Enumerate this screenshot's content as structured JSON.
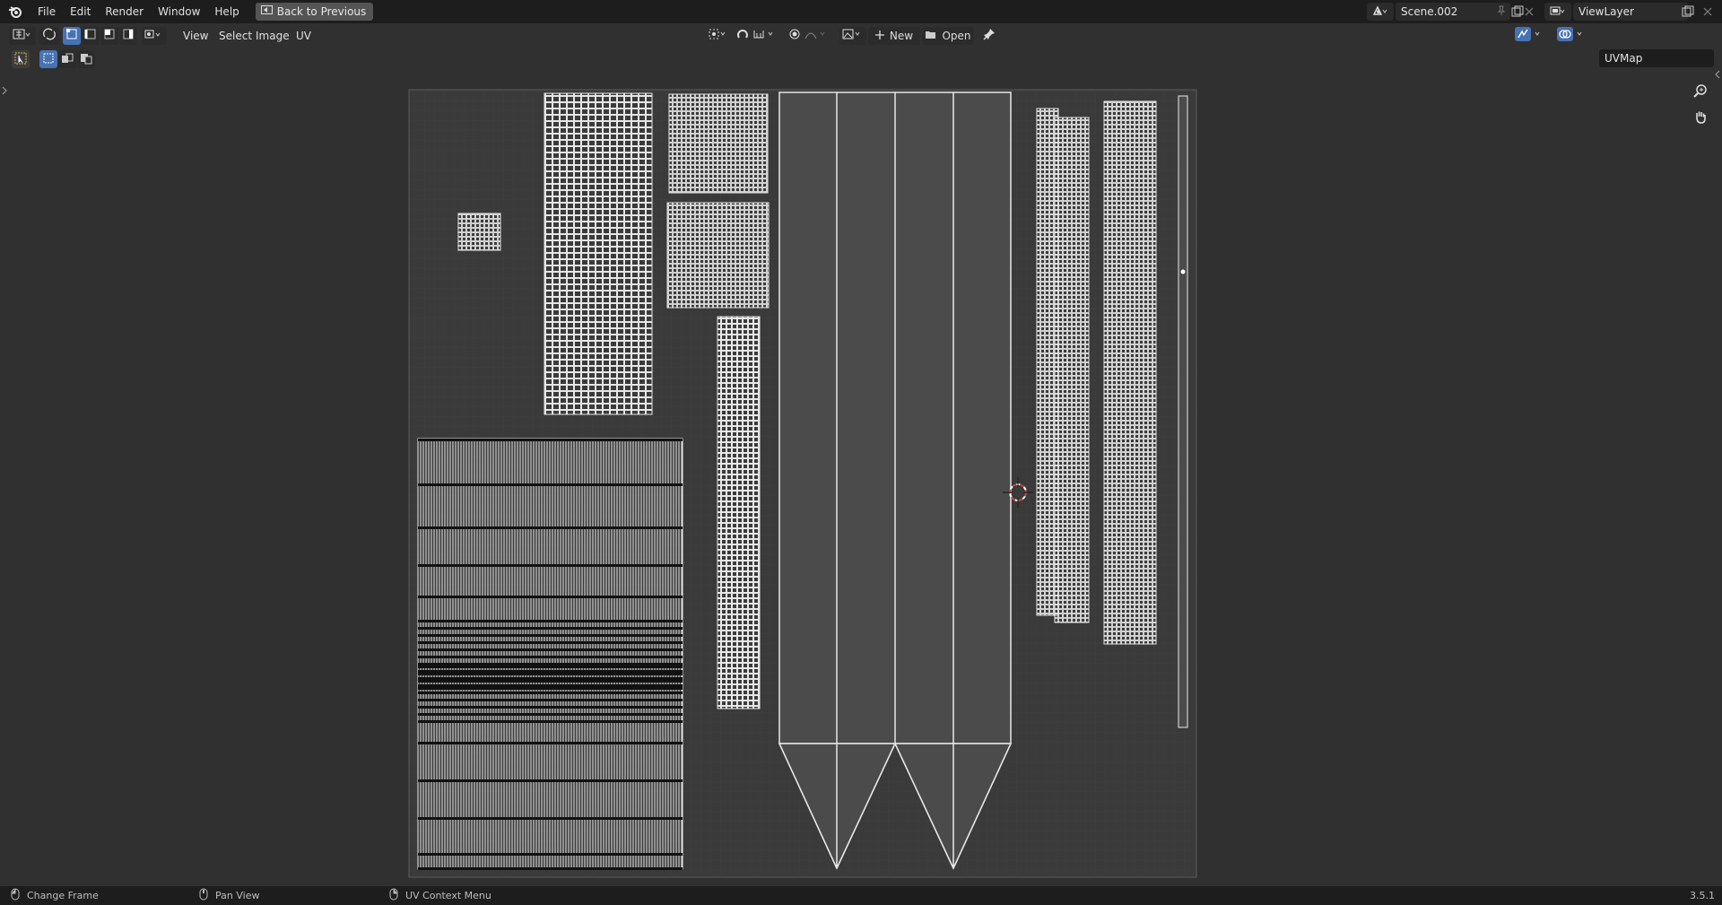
{
  "menu": {
    "file": "File",
    "edit": "Edit",
    "render": "Render",
    "window": "Window",
    "help": "Help"
  },
  "back_button": "Back to Previous",
  "scene": {
    "name": "Scene.002"
  },
  "view_layer": {
    "name": "ViewLayer"
  },
  "editor_menu": {
    "view": "View",
    "select": "Select",
    "image": "Image",
    "uv": "UV"
  },
  "image_controls": {
    "new_label": "New",
    "open_label": "Open"
  },
  "uv_map": {
    "name": "UVMap"
  },
  "status": {
    "left": "Change Frame",
    "middle": "Pan View",
    "right": "UV Context Menu",
    "version": "3.5.1"
  },
  "colors": {
    "accent": "#4772b3",
    "topbar": "#1d1d1d",
    "background": "#303030",
    "uv_area": "#3a3a3a",
    "cursor": "#d04040"
  },
  "icons": [
    "blender-logo-icon",
    "back-screen-icon",
    "scene-icon",
    "pin-icon",
    "duplicate-icon",
    "close-icon",
    "view-layer-icon",
    "editor-type-icon",
    "sync-selection-icon",
    "vertex-select-icon",
    "edge-select-icon",
    "face-select-icon",
    "island-select-icon",
    "sticky-select-icon",
    "pivot-icon",
    "snap-icon",
    "proportional-icon",
    "image-browse-icon",
    "plus-icon",
    "folder-icon",
    "pin-icon",
    "gizmo-icon",
    "overlay-icon",
    "zoom-icon",
    "hand-icon",
    "select-box-icon",
    "mouse-icon"
  ]
}
